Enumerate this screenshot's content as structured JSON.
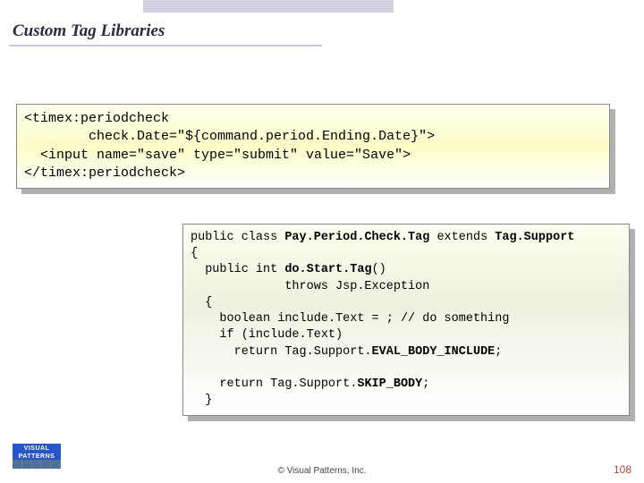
{
  "title": "Custom Tag Libraries",
  "code1": {
    "line1": "<timex:periodcheck",
    "line2": "        check.Date=\"${command.period.Ending.Date}\">",
    "line3": "  <input name=\"save\" type=\"submit\" value=\"Save\">",
    "line4": "</timex:periodcheck>"
  },
  "code2": {
    "line1a": "public class ",
    "line1b": "Pay.Period.Check.Tag",
    "line1c": " extends ",
    "line1d": "Tag.Support",
    "line2": "{",
    "line3a": "  public int ",
    "line3b": "do.Start.Tag",
    "line3c": "()",
    "line4": "             throws Jsp.Exception",
    "line5": "  {",
    "line6": "    boolean include.Text = ; // do something",
    "line7": "    if (include.Text)",
    "line8a": "      return Tag.Support.",
    "line8b": "EVAL_BODY_INCLUDE",
    "line8c": ";",
    "line9": "",
    "line10a": "    return Tag.Support.",
    "line10b": "SKIP_BODY",
    "line10c": ";",
    "line11": "  }"
  },
  "logo": {
    "top1": "VISUAL",
    "top2": "PATTERNS"
  },
  "footer": "© Visual Patterns, Inc.",
  "page": "108"
}
